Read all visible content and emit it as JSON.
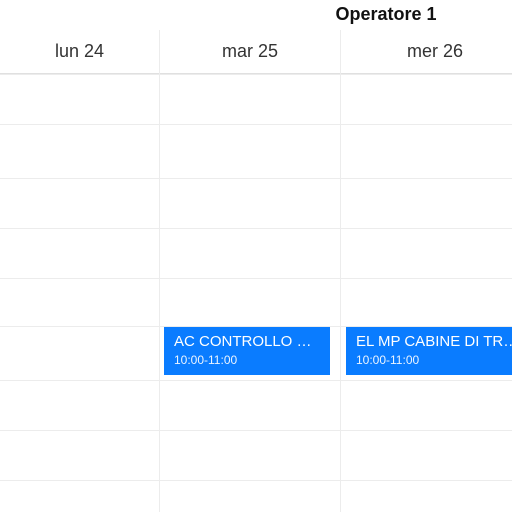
{
  "operator": {
    "title": "Operatore 1"
  },
  "columns": [
    {
      "label": "lun 24"
    },
    {
      "label": "mar 25"
    },
    {
      "label": "mer 26"
    }
  ],
  "events": [
    {
      "col": 1,
      "title": "AC CONTROLLO SETTI...",
      "time": "10:00-11:00"
    },
    {
      "col": 2,
      "title": "EL MP CABINE DI TRA...",
      "time": "10:00-11:00"
    }
  ],
  "colors": {
    "event_bg": "#0a7cff"
  }
}
